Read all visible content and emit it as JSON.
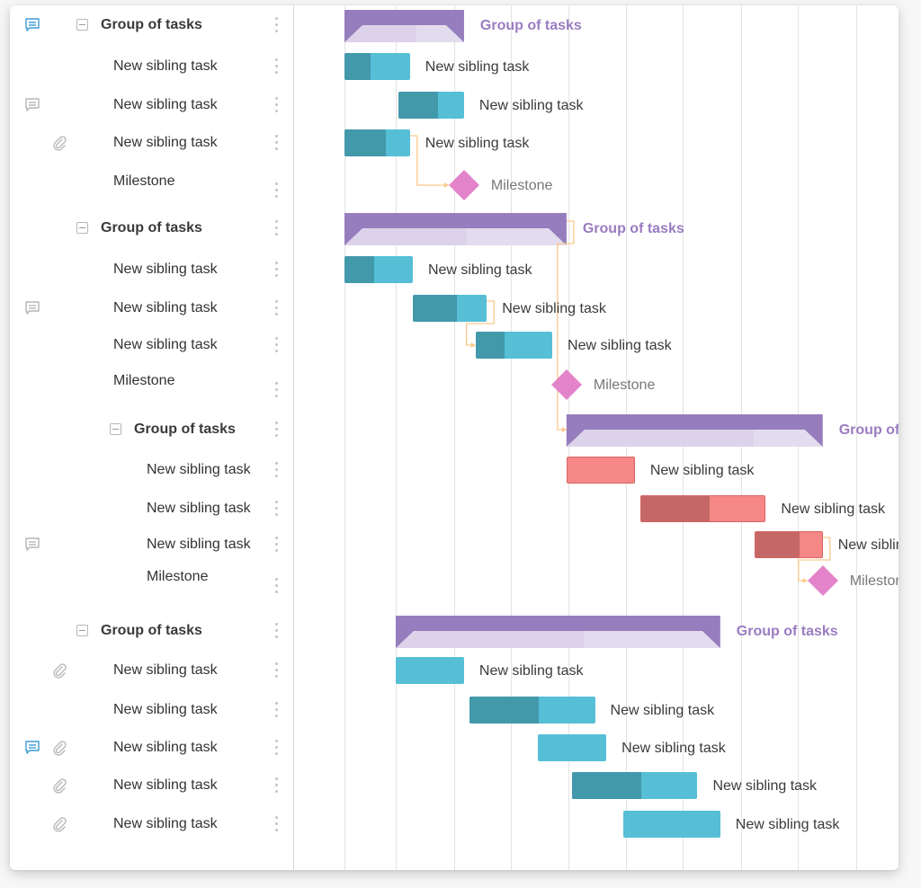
{
  "colors": {
    "group": "#967dbd",
    "group_light": "#e3dcee",
    "task_blue": "#56bfd6",
    "task_blue_progress": "#4299aa",
    "task_red": "#f58787",
    "task_red_progress": "#c56767",
    "milestone": "#e384cb",
    "link": "#f9c98a",
    "comment_active": "#3b9bd6",
    "icon_gray": "#b5b5b5"
  },
  "timeline": {
    "columns": 12
  },
  "rows": [
    {
      "type": "group",
      "label": "Group of tasks",
      "level": 0,
      "comment": "active",
      "attachment": false,
      "start": 0,
      "end": 2.1,
      "progress": 0.6
    },
    {
      "type": "task",
      "label": "New sibling task",
      "level": 1,
      "comment": null,
      "attachment": false,
      "start": 0,
      "end": 1.15,
      "progress": 0.4,
      "color": "blue"
    },
    {
      "type": "task",
      "label": "New sibling task",
      "level": 1,
      "comment": "inactive",
      "attachment": false,
      "start": 0.95,
      "end": 2.1,
      "progress": 0.6,
      "color": "blue"
    },
    {
      "type": "task",
      "label": "New sibling task",
      "level": 1,
      "comment": null,
      "attachment": true,
      "start": 0,
      "end": 1.15,
      "progress": 0.63,
      "color": "blue"
    },
    {
      "type": "milestone",
      "label": "Milestone",
      "level": 1,
      "comment": null,
      "attachment": false,
      "at": 2.1
    },
    {
      "type": "group",
      "label": "Group of tasks",
      "level": 0,
      "comment": null,
      "attachment": false,
      "start": 0,
      "end": 3.9,
      "progress": 0.55
    },
    {
      "type": "task",
      "label": "New sibling task",
      "level": 1,
      "comment": null,
      "attachment": false,
      "start": 0,
      "end": 1.2,
      "progress": 0.43,
      "color": "blue"
    },
    {
      "type": "task",
      "label": "New sibling task",
      "level": 1,
      "comment": "inactive",
      "attachment": false,
      "start": 1.2,
      "end": 2.5,
      "progress": 0.6,
      "color": "blue"
    },
    {
      "type": "task",
      "label": "New sibling task",
      "level": 1,
      "comment": null,
      "attachment": false,
      "start": 2.3,
      "end": 3.65,
      "progress": 0.38,
      "color": "blue"
    },
    {
      "type": "milestone",
      "label": "Milestone",
      "level": 1,
      "comment": null,
      "attachment": false,
      "at": 3.9
    },
    {
      "type": "group",
      "label": "Group of tasks",
      "level": 1,
      "comment": null,
      "attachment": false,
      "start": 3.9,
      "end": 8.4,
      "progress": 0.73
    },
    {
      "type": "task",
      "label": "New sibling task",
      "level": 2,
      "comment": null,
      "attachment": false,
      "start": 3.9,
      "end": 5.1,
      "progress": 0,
      "color": "red"
    },
    {
      "type": "task",
      "label": "New sibling task",
      "level": 2,
      "comment": null,
      "attachment": false,
      "start": 5.2,
      "end": 7.4,
      "progress": 0.55,
      "color": "red"
    },
    {
      "type": "task",
      "label": "New sibling task",
      "level": 2,
      "comment": "inactive",
      "attachment": false,
      "start": 7.2,
      "end": 8.4,
      "progress": 0.67,
      "color": "red"
    },
    {
      "type": "milestone",
      "label": "Milestone",
      "level": 2,
      "comment": null,
      "attachment": false,
      "at": 8.4
    },
    {
      "type": "group",
      "label": "Group of tasks",
      "level": 0,
      "comment": null,
      "attachment": false,
      "start": 0.9,
      "end": 6.6,
      "progress": 0.58
    },
    {
      "type": "task",
      "label": "New sibling task",
      "level": 1,
      "comment": null,
      "attachment": true,
      "start": 0.9,
      "end": 2.1,
      "progress": 0,
      "color": "blue"
    },
    {
      "type": "task",
      "label": "New sibling task",
      "level": 1,
      "comment": null,
      "attachment": false,
      "start": 2.2,
      "end": 4.4,
      "progress": 0.55,
      "color": "blue"
    },
    {
      "type": "task",
      "label": "New sibling task",
      "level": 1,
      "comment": "active",
      "attachment": true,
      "start": 3.4,
      "end": 4.6,
      "progress": 0,
      "color": "blue"
    },
    {
      "type": "task",
      "label": "New sibling task",
      "level": 1,
      "comment": null,
      "attachment": true,
      "start": 4.0,
      "end": 6.2,
      "progress": 0.55,
      "color": "blue"
    },
    {
      "type": "task",
      "label": "New sibling task",
      "level": 1,
      "comment": null,
      "attachment": true,
      "start": 4.9,
      "end": 6.6,
      "progress": 0,
      "color": "blue"
    }
  ],
  "links": [
    {
      "from": 3,
      "to": 4
    },
    {
      "from": 5,
      "to": 10
    },
    {
      "from": 7,
      "to": 8
    },
    {
      "from": 13,
      "to": 14
    }
  ]
}
